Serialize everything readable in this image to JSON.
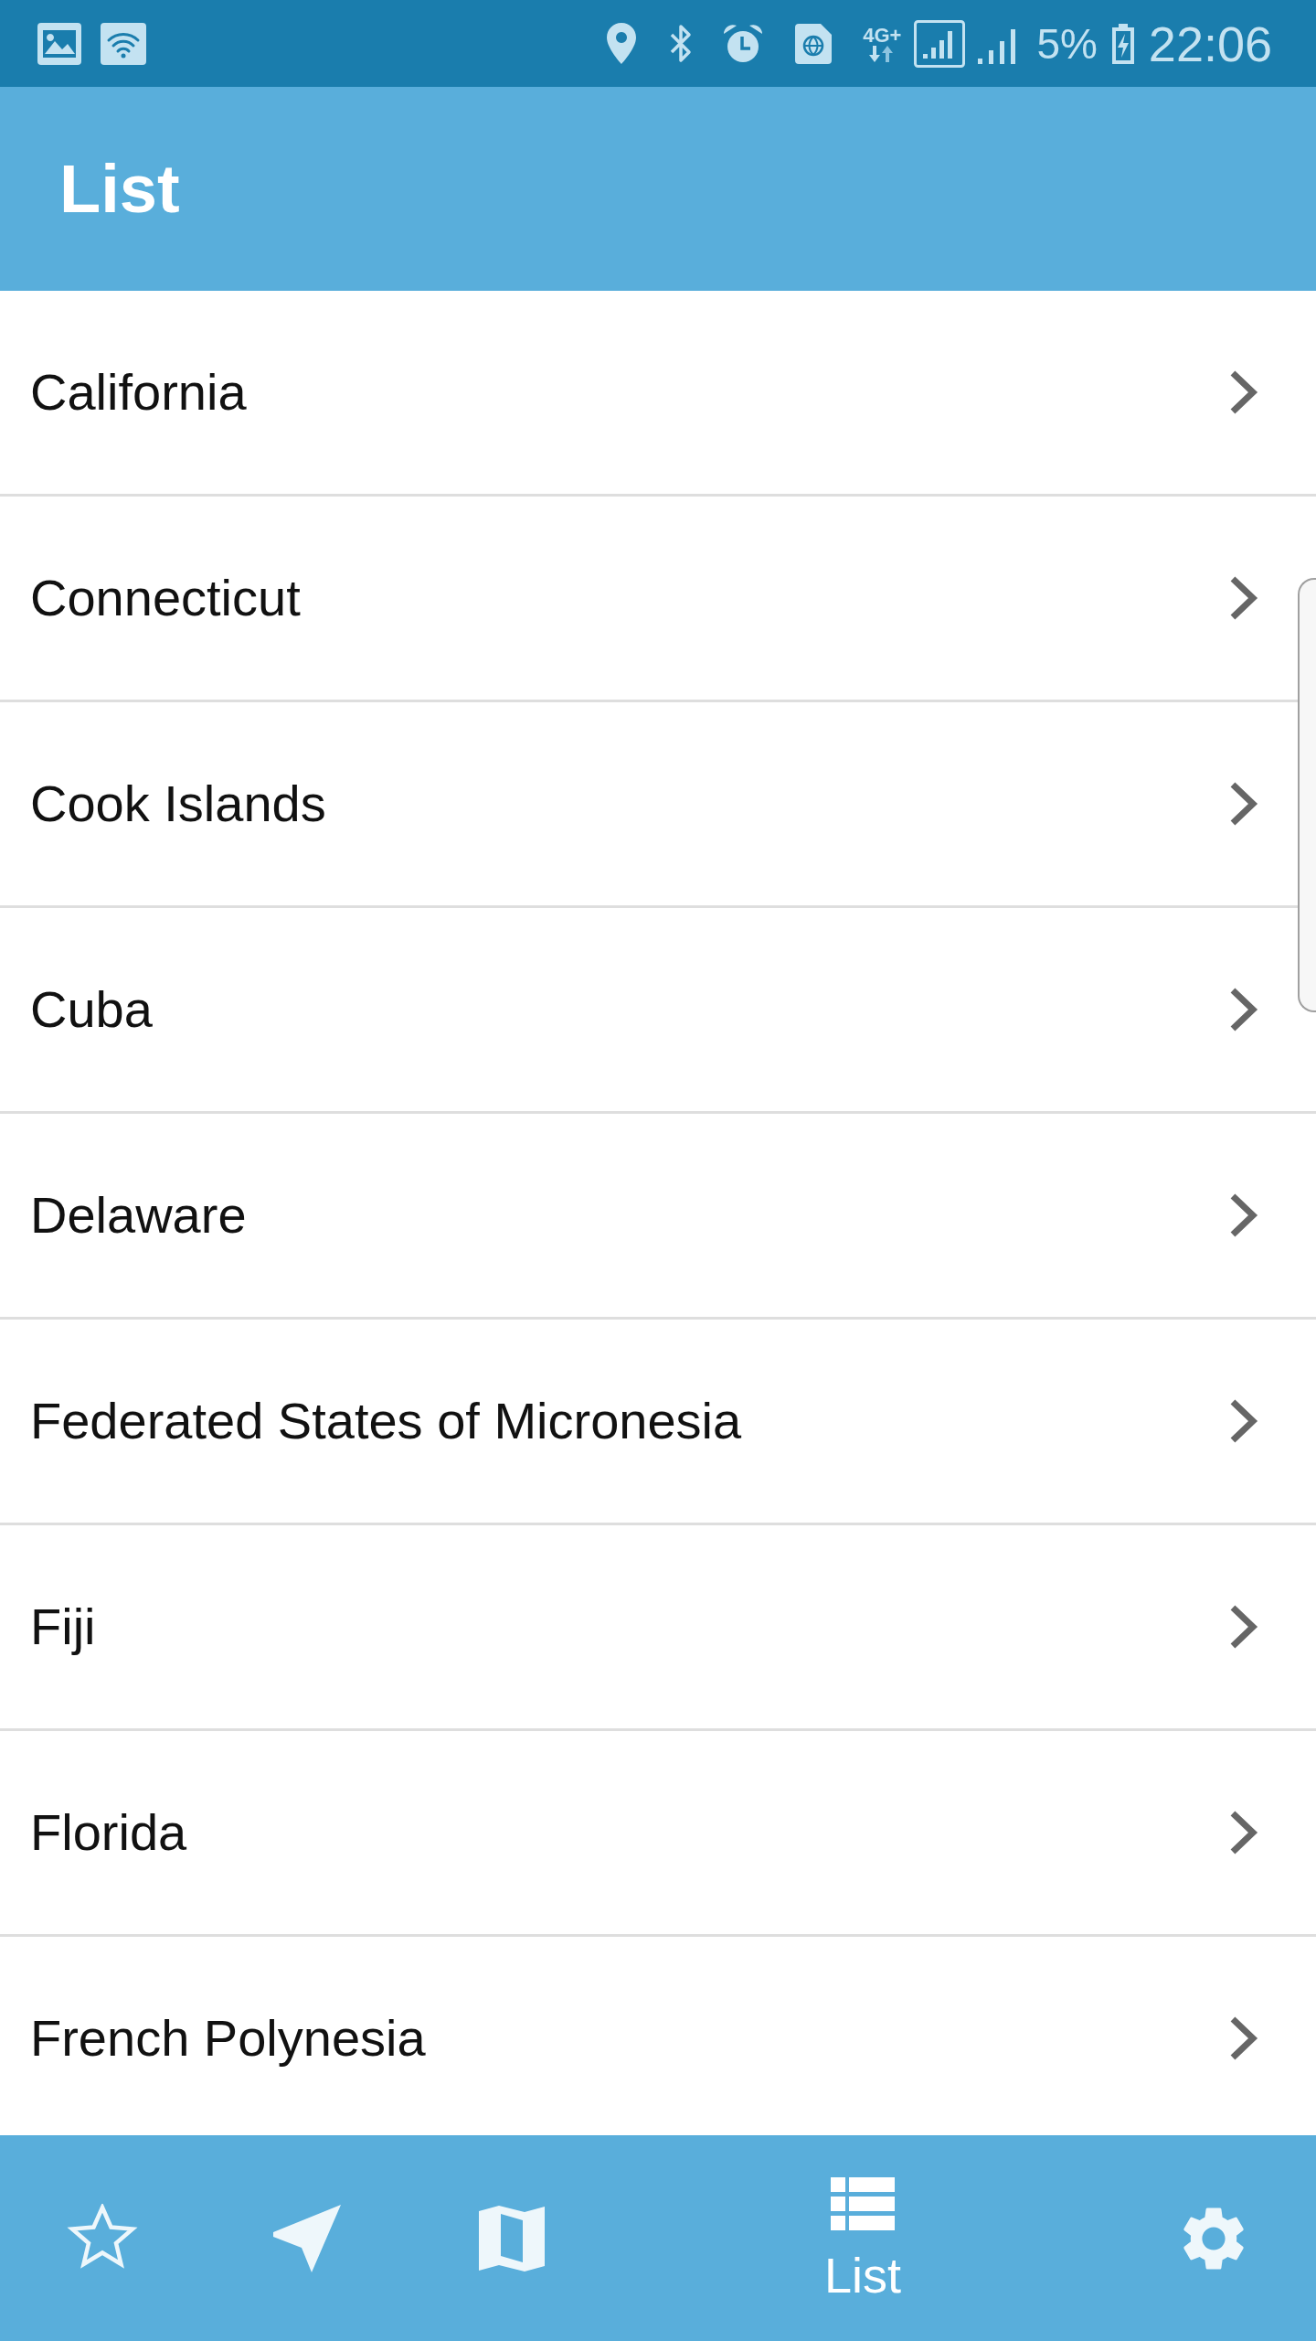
{
  "status_bar": {
    "network_type": "4G+",
    "battery": "5%",
    "time": "22:06"
  },
  "header": {
    "title": "List"
  },
  "list": {
    "items": [
      "California",
      "Connecticut",
      "Cook Islands",
      "Cuba",
      "Delaware",
      "Federated States of Micronesia",
      "Fiji",
      "Florida",
      "French Polynesia"
    ]
  },
  "bottom_nav": {
    "tabs": [
      {
        "selected": false
      },
      {
        "selected": false
      },
      {
        "selected": false
      },
      {
        "label": "List",
        "selected": true
      },
      {
        "selected": false
      }
    ]
  }
}
